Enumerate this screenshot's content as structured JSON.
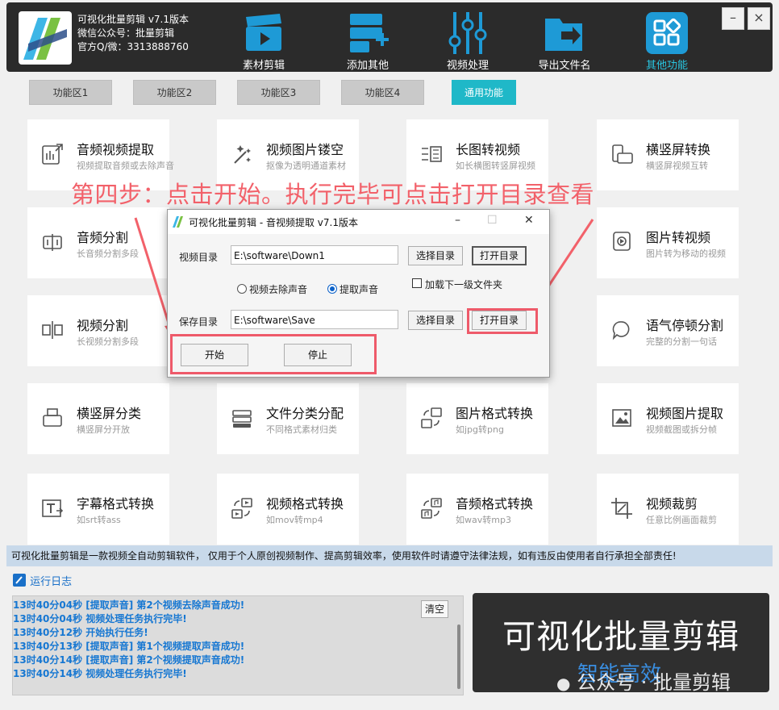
{
  "header": {
    "title_line1": "可视化批量剪辑 v7.1版本",
    "title_line2": "微信公众号：批量剪辑",
    "title_line3": "官方Q/微：3313888760",
    "nav": [
      {
        "label": "素材剪辑",
        "icon": "clapperboard-icon"
      },
      {
        "label": "添加其他",
        "icon": "add-server-icon"
      },
      {
        "label": "视频处理",
        "icon": "sliders-icon"
      },
      {
        "label": "导出文件名",
        "icon": "folder-export-icon"
      },
      {
        "label": "其他功能",
        "icon": "apps-grid-icon"
      }
    ],
    "active_nav": "其他功能",
    "minimize": "–",
    "close": "×"
  },
  "tabs": [
    "功能区1",
    "功能区2",
    "功能区3",
    "功能区4",
    "通用功能"
  ],
  "active_tab": "通用功能",
  "cards": [
    {
      "title": "音频视频提取",
      "sub": "视频提取音频或去除声音",
      "icon": "audio-extract-icon"
    },
    {
      "title": "视频图片镂空",
      "sub": "抠像为透明通道素材",
      "icon": "magic-wand-icon"
    },
    {
      "title": "长图转视频",
      "sub": "如长横图转竖屏视频",
      "icon": "long-image-icon"
    },
    {
      "title": "横竖屏转换",
      "sub": "横竖屏视频互转",
      "icon": "rotate-screen-icon"
    },
    {
      "title": "音频分割",
      "sub": "长音频分割多段",
      "icon": "audio-split-icon"
    },
    {
      "title": "图片转视频",
      "sub": "图片转为移动的视频",
      "icon": "image-video-icon"
    },
    {
      "title": "视频分割",
      "sub": "长视频分割多段",
      "icon": "video-split-icon"
    },
    {
      "title": "语气停顿分割",
      "sub": "完整的分割一句话",
      "icon": "speech-pause-icon"
    },
    {
      "title": "横竖屏分类",
      "sub": "横竖屏分开放",
      "icon": "orientation-sort-icon"
    },
    {
      "title": "文件分类分配",
      "sub": "不同格式素材归类",
      "icon": "file-sort-icon"
    },
    {
      "title": "图片格式转换",
      "sub": "如jpg转png",
      "icon": "image-convert-icon"
    },
    {
      "title": "视频图片提取",
      "sub": "视频截图或拆分帧",
      "icon": "frame-extract-icon"
    },
    {
      "title": "字幕格式转换",
      "sub": "如srt转ass",
      "icon": "subtitle-icon"
    },
    {
      "title": "视频格式转换",
      "sub": "如mov转mp4",
      "icon": "video-convert-icon"
    },
    {
      "title": "音频格式转换",
      "sub": "如wav转mp3",
      "icon": "audio-convert-icon"
    },
    {
      "title": "视频裁剪",
      "sub": "任意比例画面裁剪",
      "icon": "crop-icon"
    }
  ],
  "annotation": "第四步：点击开始。执行完毕可点击打开目录查看",
  "dialog": {
    "title": "可视化批量剪辑 - 音视频提取  v7.1版本",
    "minimize": "–",
    "maximize": "☐",
    "close": "✕",
    "video_dir_label": "视频目录",
    "video_dir_value": "E:\\software\\Down1",
    "select_dir": "选择目录",
    "open_dir": "打开目录",
    "radio_remove": "视频去除声音",
    "radio_extract": "提取声音",
    "selected_radio": "提取声音",
    "checkbox_sub": "加载下一级文件夹",
    "checkbox_checked": false,
    "save_dir_label": "保存目录",
    "save_dir_value": "E:\\software\\Save",
    "start": "开始",
    "stop": "停止"
  },
  "disclaimer": "可视化批量剪辑是一款视频全自动剪辑软件， 仅用于个人原创视频制作、提高剪辑效率，使用软件时请遵守法律法规，如有违反由使用者自行承担全部责任!",
  "log": {
    "title": "运行日志",
    "clear": "清空",
    "lines": [
      "13时40分04秒 [提取声音] 第2个视频去除声音成功!",
      "13时40分04秒 视频处理任务执行完毕!",
      "13时40分12秒 开始执行任务!",
      "13时40分13秒 [提取声音] 第1个视频提取声音成功!",
      "13时40分14秒 [提取声音] 第2个视频提取声音成功!",
      "13时40分14秒 视频处理任务执行完毕!"
    ]
  },
  "brand": {
    "title": "可视化批量剪辑",
    "subtitle": "智能高效",
    "watermark": "公众号 · 批量剪辑"
  },
  "colors": {
    "accent": "#1fb8c8",
    "nav_icon": "#1e9ad6",
    "annotation_red": "#f2616a",
    "log_blue": "#1677d2"
  }
}
